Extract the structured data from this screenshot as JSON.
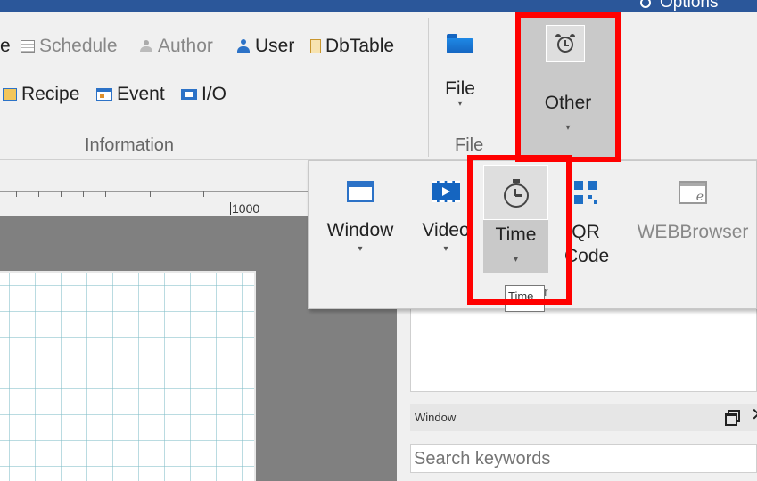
{
  "titlebar": {
    "options_label": "Options"
  },
  "ribbon": {
    "information_group": {
      "label": "Information",
      "row1": [
        {
          "label": "e",
          "icon": "none",
          "dim": false
        },
        {
          "label": "Schedule",
          "icon": "schedule-icon",
          "dim": true
        },
        {
          "label": "Author",
          "icon": "author-icon",
          "dim": true
        },
        {
          "label": "User",
          "icon": "user-icon",
          "dim": false
        },
        {
          "label": "DbTable",
          "icon": "dbtable-icon",
          "dim": false
        }
      ],
      "row2": [
        {
          "label": "Recipe",
          "icon": "recipe-icon"
        },
        {
          "label": "Event",
          "icon": "event-icon"
        },
        {
          "label": "I/O",
          "icon": "io-icon"
        }
      ]
    },
    "file_group": {
      "label": "File",
      "button_label": "File"
    },
    "other_button": {
      "label": "Other"
    }
  },
  "ruler": {
    "label": "1000"
  },
  "dropdown": {
    "items": [
      {
        "label": "Window"
      },
      {
        "label": "Video"
      },
      {
        "label": "Time"
      },
      {
        "label": "QR"
      },
      {
        "label2": "Code"
      },
      {
        "label": "WEBBrowser"
      }
    ],
    "group_label_fragment": "er"
  },
  "tooltip": {
    "text": "Time"
  },
  "panel": {
    "window_title": "Window",
    "search_placeholder": "Search keywords"
  },
  "colors": {
    "highlight": "#ff0000",
    "accent": "#2b579a"
  }
}
